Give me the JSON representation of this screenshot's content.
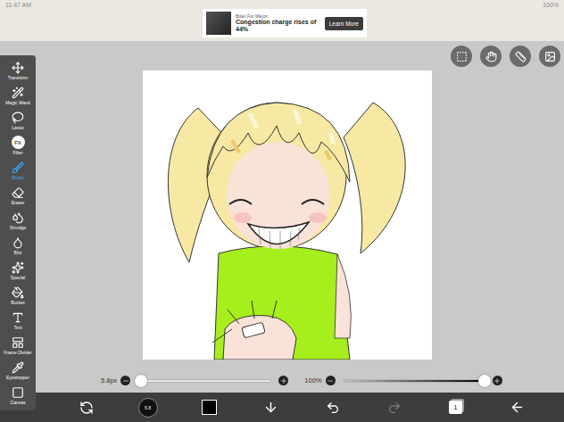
{
  "status_bar": {
    "time": "11:47 AM",
    "battery": "100%"
  },
  "ad": {
    "sponsor": "Brian For Mayor",
    "headline": "Congestion charge rises of 44%",
    "button": "Learn More"
  },
  "tools": [
    {
      "label": "Transform",
      "selected": false
    },
    {
      "label": "Magic Wand",
      "selected": false
    },
    {
      "label": "Lasso",
      "selected": false
    },
    {
      "label": "Filter",
      "selected": false,
      "icon_text": "FX"
    },
    {
      "label": "Brush",
      "selected": true
    },
    {
      "label": "Eraser",
      "selected": false
    },
    {
      "label": "Smudge",
      "selected": false
    },
    {
      "label": "Blur",
      "selected": false
    },
    {
      "label": "Special",
      "selected": false
    },
    {
      "label": "Bucket",
      "selected": false
    },
    {
      "label": "Text",
      "selected": false
    },
    {
      "label": "Frame Divider",
      "selected": false
    },
    {
      "label": "Eyedropper",
      "selected": false
    },
    {
      "label": "Canvas",
      "selected": false
    }
  ],
  "brush_size": {
    "reading": "5.8px",
    "level": 0.02
  },
  "opacity": {
    "reading": "100%",
    "level": 1
  },
  "brush_preview": {
    "reading": "5.8"
  },
  "layers": {
    "count": "1"
  },
  "history": {
    "undo_disabled": false,
    "redo_disabled": true
  }
}
